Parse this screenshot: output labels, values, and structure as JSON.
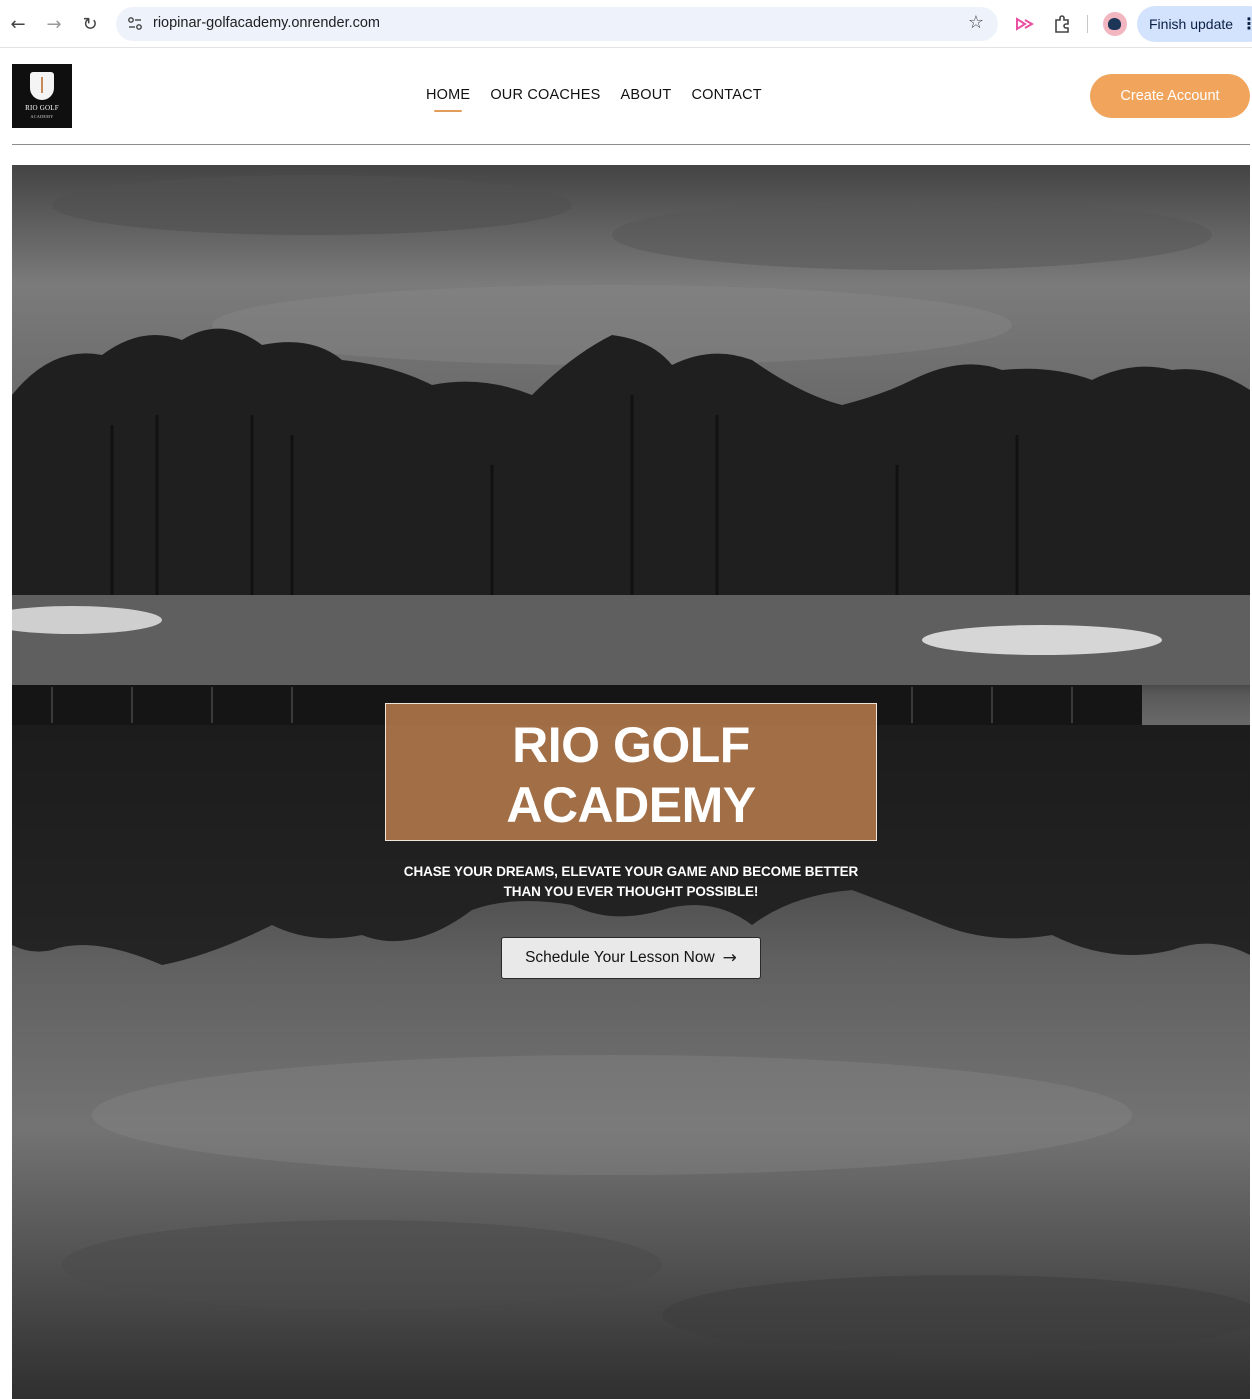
{
  "browser": {
    "url": "riopinar-golfacademy.onrender.com",
    "finish_update_label": "Finish update",
    "icons": [
      "back-arrow-icon",
      "forward-arrow-icon",
      "reload-icon",
      "site-info-icon",
      "bookmark-star-icon",
      "media-cast-icon",
      "extensions-puzzle-icon",
      "profile-avatar-icon",
      "kebab-menu-icon"
    ]
  },
  "logo": {
    "text": "RIO GOLF",
    "subtext": "ACADEMY"
  },
  "nav": {
    "items": [
      {
        "label": "HOME",
        "active": true
      },
      {
        "label": "OUR COACHES",
        "active": false
      },
      {
        "label": "ABOUT",
        "active": false
      },
      {
        "label": "CONTACT",
        "active": false
      }
    ],
    "create_account_label": "Create Account"
  },
  "hero": {
    "title_line1": "RIO GOLF",
    "title_line2": "ACADEMY",
    "tagline_line1": "CHASE YOUR DREAMS, ELEVATE YOUR GAME AND BECOME BETTER",
    "tagline_line2": "THAN YOU EVER THOUGHT POSSIBLE!",
    "cta_label": "Schedule Your Lesson Now"
  },
  "colors": {
    "accent": "#f0a45c",
    "title_box": "#be804e",
    "nav_underline": "#e39d5a"
  }
}
